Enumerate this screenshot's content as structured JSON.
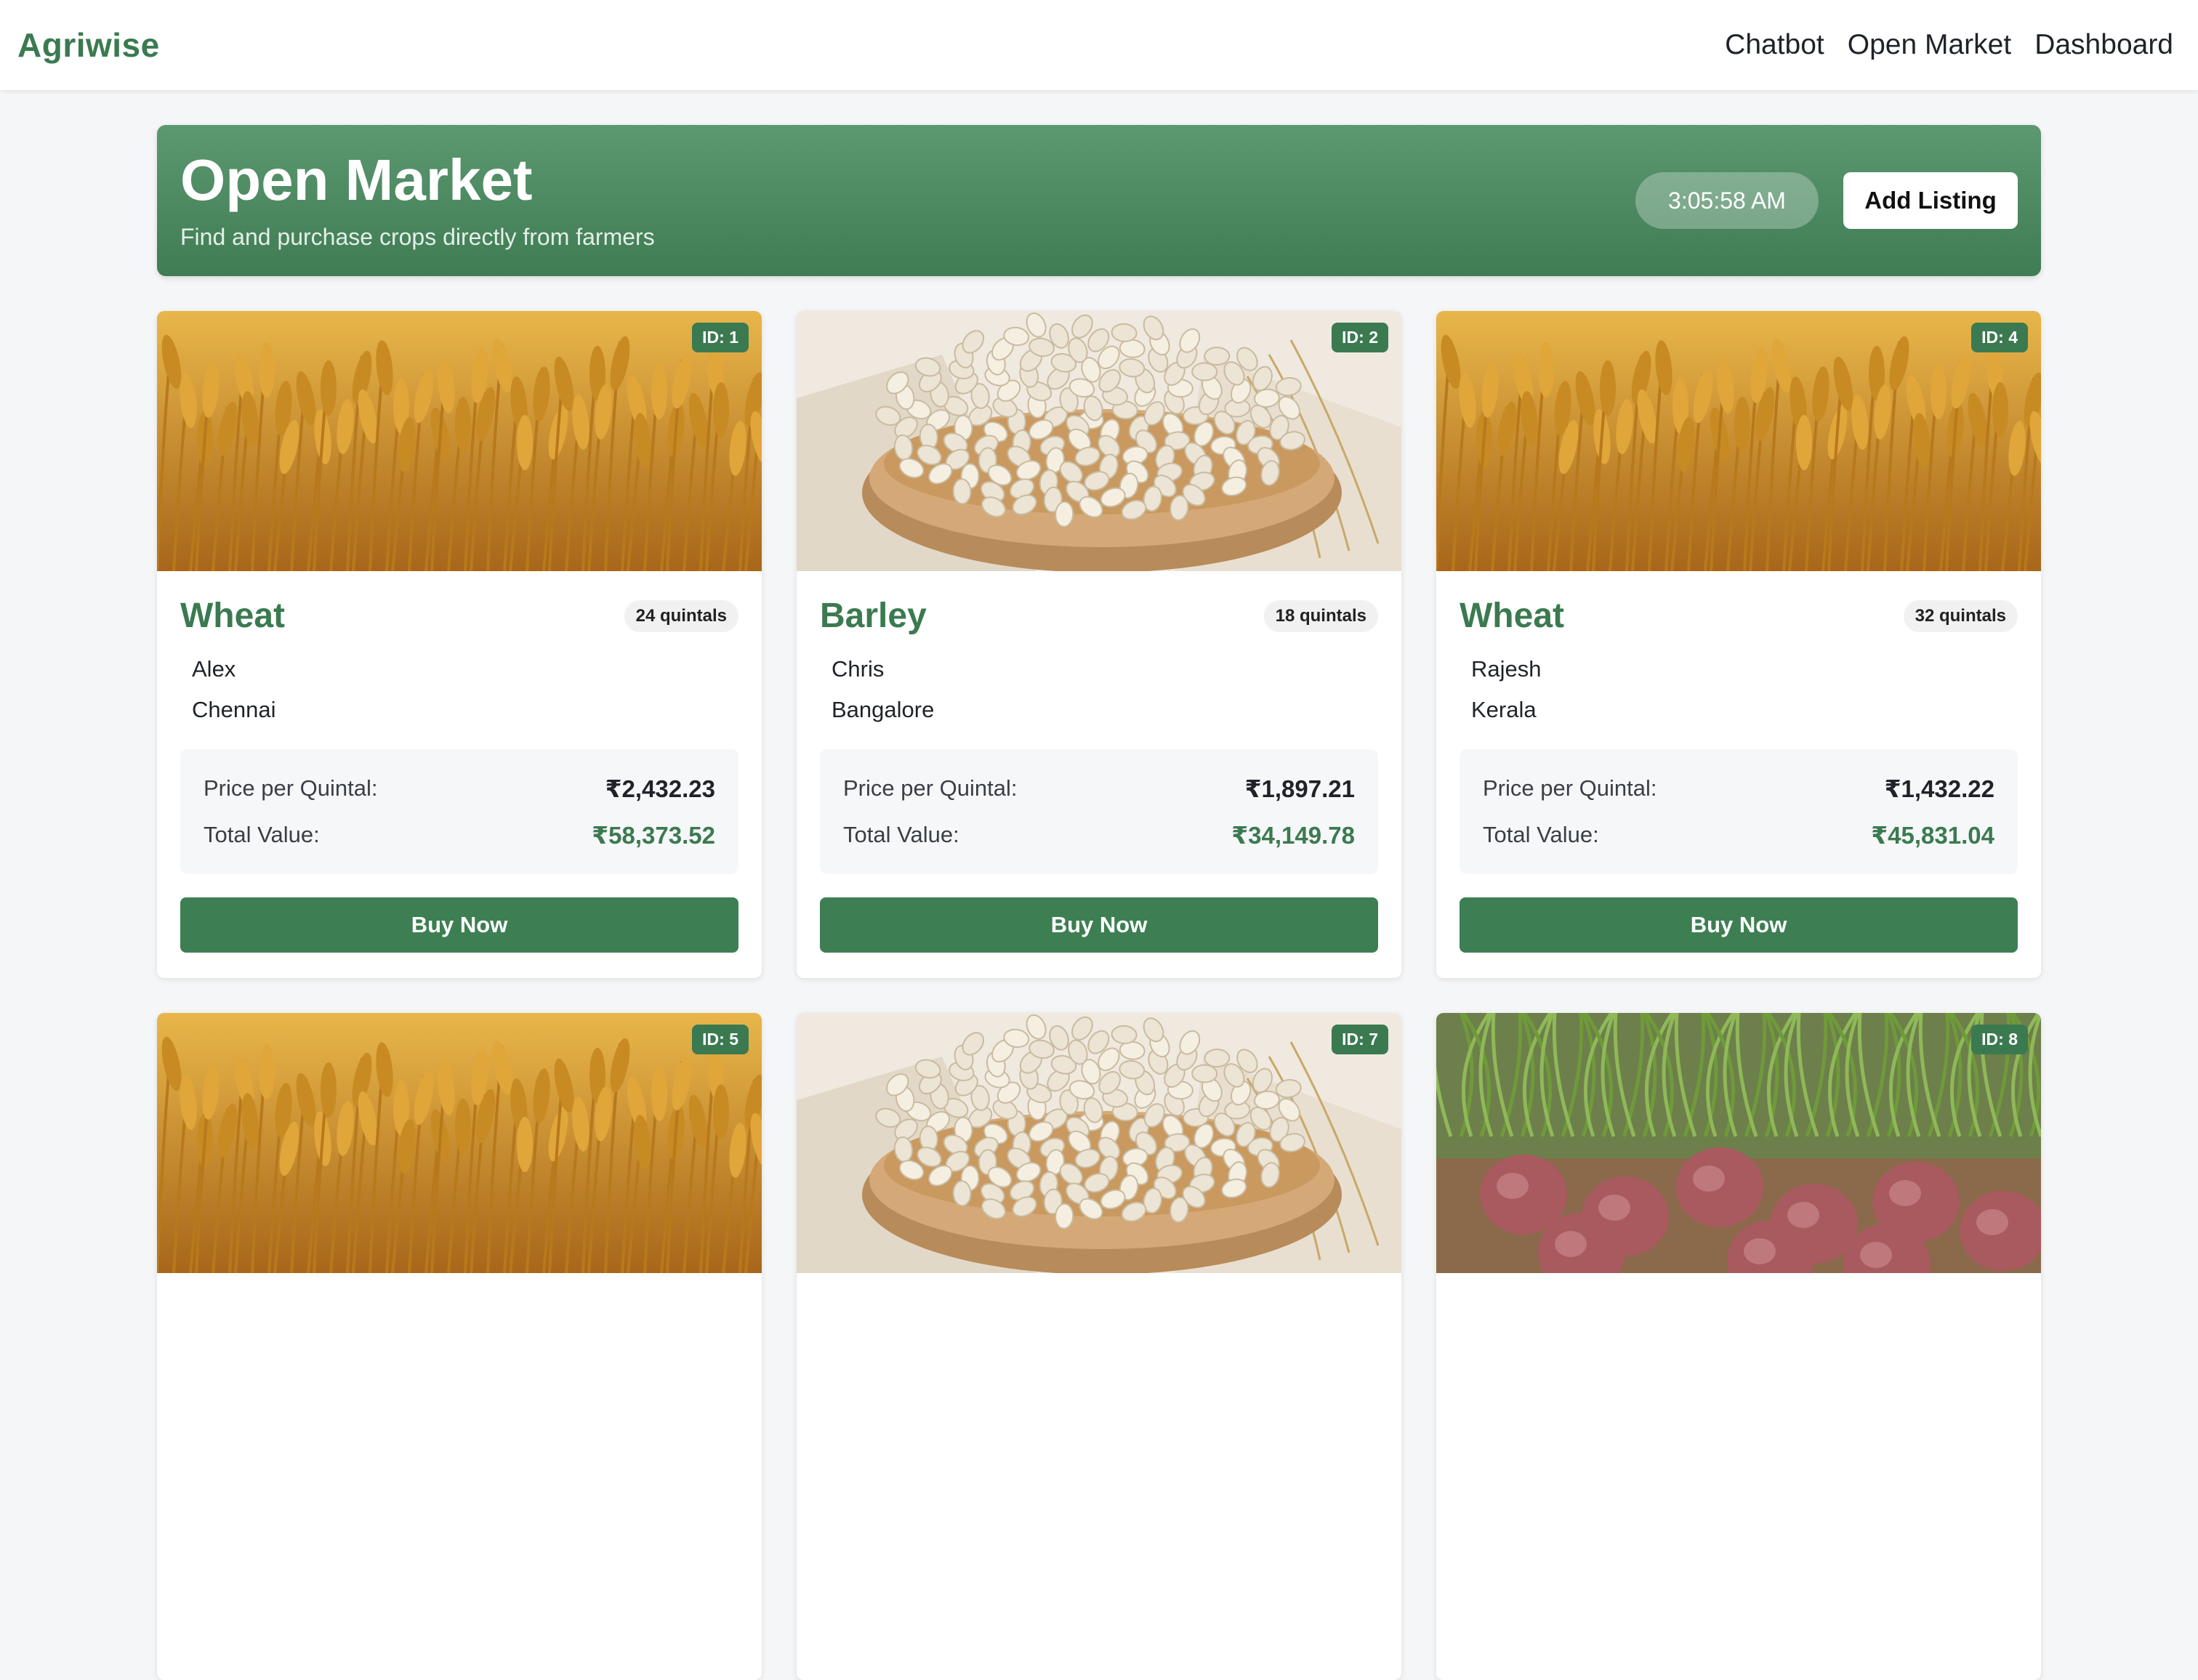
{
  "navbar": {
    "brand": "Agriwise",
    "links": [
      "Chatbot",
      "Open Market",
      "Dashboard"
    ]
  },
  "hero": {
    "title": "Open Market",
    "subtitle": "Find and purchase crops directly from farmers",
    "time": "3:05:58 AM",
    "add_label": "Add Listing"
  },
  "labels": {
    "price_per_quintal": "Price per Quintal:",
    "total_value": "Total Value:",
    "buy_now": "Buy Now"
  },
  "listings": [
    {
      "id_label": "ID: 1",
      "crop": "Wheat",
      "quantity": "24 quintals",
      "seller": "Alex",
      "location": "Chennai",
      "price": "₹2,432.23",
      "total": "₹58,373.52",
      "image": "wheat-field"
    },
    {
      "id_label": "ID: 2",
      "crop": "Barley",
      "quantity": "18 quintals",
      "seller": "Chris",
      "location": "Bangalore",
      "price": "₹1,897.21",
      "total": "₹34,149.78",
      "image": "barley-bowl"
    },
    {
      "id_label": "ID: 4",
      "crop": "Wheat",
      "quantity": "32 quintals",
      "seller": "Rajesh",
      "location": "Kerala",
      "price": "₹1,432.22",
      "total": "₹45,831.04",
      "image": "wheat-field"
    },
    {
      "id_label": "ID: 5",
      "image": "wheat-field"
    },
    {
      "id_label": "ID: 7",
      "image": "barley-bowl"
    },
    {
      "id_label": "ID: 8",
      "image": "onion-field"
    }
  ],
  "colors": {
    "brand": "#3b7a50",
    "hero": "#4a875d"
  }
}
